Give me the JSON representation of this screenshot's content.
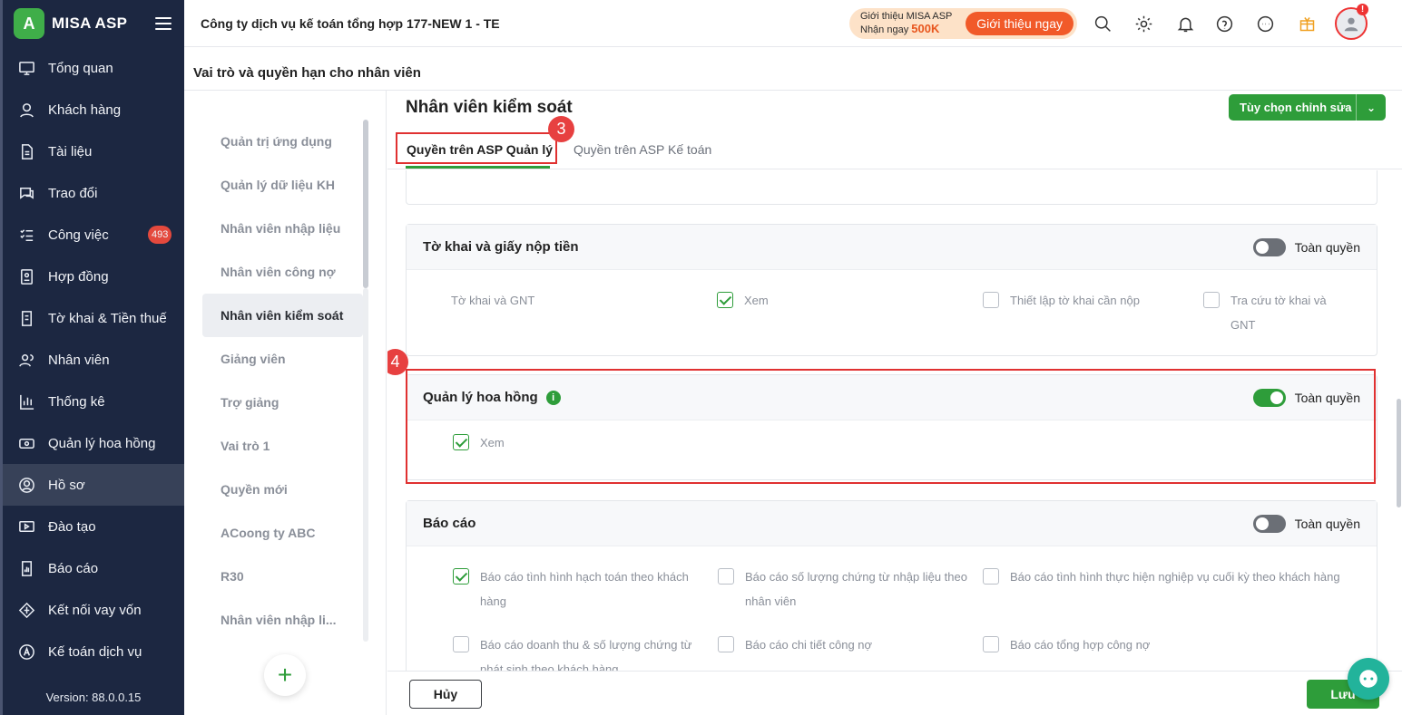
{
  "app": {
    "logo_mark": "A",
    "name": "MISA ASP"
  },
  "sidebar": {
    "items": [
      {
        "label": "Tổng quan",
        "icon": "dashboard-icon"
      },
      {
        "label": "Khách hàng",
        "icon": "user-icon"
      },
      {
        "label": "Tài liệu",
        "icon": "document-icon"
      },
      {
        "label": "Trao đổi",
        "icon": "chat-icon"
      },
      {
        "label": "Công việc",
        "icon": "task-list-icon",
        "badge": "493"
      },
      {
        "label": "Hợp đồng",
        "icon": "contract-icon"
      },
      {
        "label": "Tờ khai & Tiền thuế",
        "icon": "tax-form-icon"
      },
      {
        "label": "Nhân viên",
        "icon": "staff-icon"
      },
      {
        "label": "Thống kê",
        "icon": "chart-icon"
      },
      {
        "label": "Quản lý hoa hồng",
        "icon": "commission-icon"
      },
      {
        "label": "Hồ sơ",
        "icon": "profile-icon",
        "active": true
      },
      {
        "label": "Đào tạo",
        "icon": "training-icon"
      },
      {
        "label": "Báo cáo",
        "icon": "report-icon"
      },
      {
        "label": "Kết nối vay vốn",
        "icon": "loan-icon"
      },
      {
        "label": "Kế toán dịch vụ",
        "icon": "accounting-icon"
      }
    ],
    "version": "Version: 88.0.0.15"
  },
  "topbar": {
    "company": "Công ty dịch vụ kế toán tổng hợp 177-NEW 1 - TE",
    "promo_line1": "Giới thiệu MISA ASP",
    "promo_line2": "Nhận ngay",
    "promo_amount": "500K",
    "promo_button": "Giới thiệu ngay",
    "avatar_alert": "!"
  },
  "page": {
    "title": "Vai trò và quyền hạn cho nhân viên"
  },
  "roles": {
    "items": [
      "Quản trị ứng dụng",
      "Quản lý dữ liệu KH",
      "Nhân viên nhập liệu",
      "Nhân viên công nợ",
      "Nhân viên kiểm soát",
      "Giảng viên",
      "Trợ giảng",
      "Vai trò 1",
      "Quyền mới",
      "ACoong ty ABC",
      "R30",
      "Nhân viên nhập li..."
    ],
    "active_index": 4,
    "add_symbol": "+"
  },
  "main": {
    "title": "Nhân viên kiểm soát",
    "edit_button": "Tùy chọn chỉnh sửa",
    "tabs": [
      "Quyền trên ASP Quản lý",
      "Quyền trên ASP Kế toán"
    ],
    "step3": "3",
    "step4": "4",
    "sections": {
      "tokhai": {
        "title": "Tờ khai và giấy nộp tiền",
        "toggle_label": "Toàn quyền",
        "toggle_on": false,
        "row_label": "Tờ khai và GNT",
        "perms": [
          {
            "label": "Xem",
            "checked": true
          },
          {
            "label": "Thiết lập tờ khai cần nộp",
            "checked": false
          },
          {
            "label": "Tra cứu tờ khai và GNT",
            "checked": false
          }
        ]
      },
      "hoahong": {
        "title": "Quản lý hoa hồng",
        "info": "i",
        "toggle_label": "Toàn quyền",
        "toggle_on": true,
        "perms": [
          {
            "label": "Xem",
            "checked": true
          }
        ]
      },
      "baocao": {
        "title": "Báo cáo",
        "toggle_label": "Toàn quyền",
        "toggle_on": false,
        "perms": [
          {
            "label": "Báo cáo tình hình hạch toán theo khách hàng",
            "checked": true
          },
          {
            "label": "Báo cáo số lượng chứng từ nhập liệu theo nhân viên",
            "checked": false
          },
          {
            "label": "Báo cáo tình hình thực hiện nghiệp vụ cuối kỳ theo khách hàng",
            "checked": false
          },
          {
            "label": "Báo cáo doanh thu & số lượng chứng từ phát sinh theo khách hàng",
            "checked": false
          },
          {
            "label": "Báo cáo chi tiết công nợ",
            "checked": false
          },
          {
            "label": "Báo cáo tổng hợp công nợ",
            "checked": false
          }
        ]
      }
    }
  },
  "footer": {
    "cancel": "Hủy",
    "save": "Lưu"
  },
  "colors": {
    "sidebar": "#1c2741",
    "accent": "#2e9d3a",
    "highlight": "#e03131",
    "promo": "#f15a29"
  }
}
